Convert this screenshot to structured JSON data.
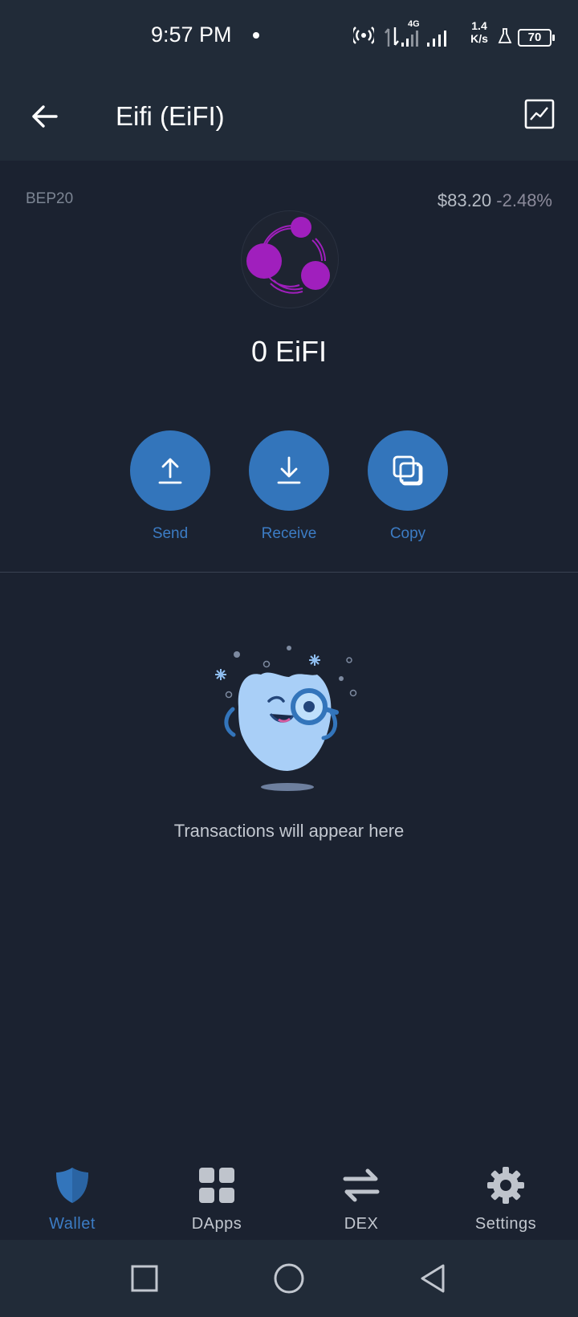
{
  "status_bar": {
    "time": "9:57 PM",
    "network_type": "4G",
    "net_speed_value": "1.4",
    "net_speed_unit": "K/s",
    "battery": "70"
  },
  "header": {
    "title": "Eifi (EiFI)",
    "back_icon": "arrow-left-icon",
    "chart_icon": "line-chart-icon"
  },
  "token": {
    "network": "BEP20",
    "price": "$83.20",
    "change": "-2.48%",
    "balance": "0 EiFI",
    "logo_color": "#a01fbd"
  },
  "actions": [
    {
      "label": "Send",
      "icon": "upload-arrow-icon"
    },
    {
      "label": "Receive",
      "icon": "download-arrow-icon"
    },
    {
      "label": "Copy",
      "icon": "copy-icon"
    }
  ],
  "empty_state": {
    "message": "Transactions will appear here",
    "illustration": "mascot-magnifier-illustration"
  },
  "bottom_nav": [
    {
      "label": "Wallet",
      "icon": "shield-icon",
      "active": true
    },
    {
      "label": "DApps",
      "icon": "grid-icon",
      "active": false
    },
    {
      "label": "DEX",
      "icon": "swap-arrows-icon",
      "active": false
    },
    {
      "label": "Settings",
      "icon": "gear-icon",
      "active": false
    }
  ],
  "colors": {
    "accent": "#3375bb",
    "background": "#1b2230",
    "header": "#212b38"
  }
}
